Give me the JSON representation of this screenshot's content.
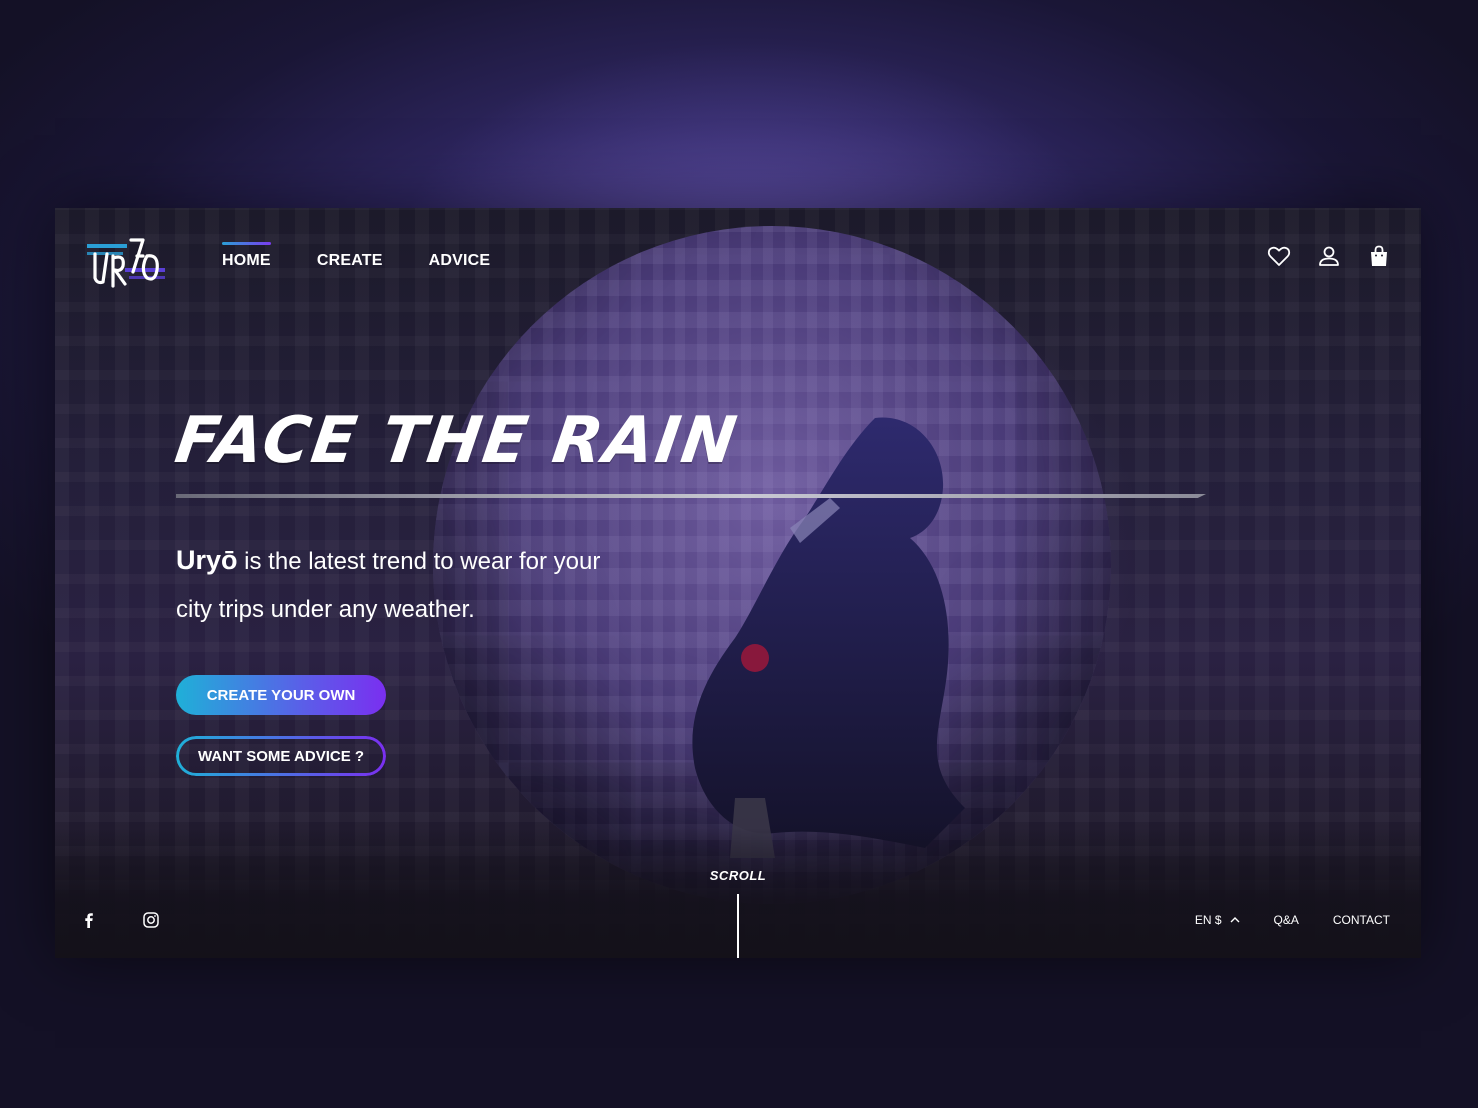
{
  "brand": {
    "logo_text": "URYŌ"
  },
  "nav": {
    "items": [
      {
        "label": "HOME",
        "active": true
      },
      {
        "label": "CREATE",
        "active": false
      },
      {
        "label": "ADVICE",
        "active": false
      }
    ]
  },
  "header_icons": [
    "heart-icon",
    "user-icon",
    "shopping-bag-icon"
  ],
  "hero": {
    "title": "FACE THE RAIN",
    "brand_word": "Uryō",
    "description": " is the latest trend to wear for your city trips under any weather.",
    "primary_button": "CREATE YOUR OWN",
    "secondary_button": "WANT SOME ADVICE ?"
  },
  "footer": {
    "scroll_label": "SCROLL",
    "social": [
      "facebook-icon",
      "instagram-icon"
    ],
    "locale": "EN $",
    "qa": "Q&A",
    "contact": "CONTACT"
  },
  "colors": {
    "accent_start": "#1fb0d8",
    "accent_end": "#7a2ff0",
    "frame_bg": "#1c1a2a",
    "text": "#ffffff"
  }
}
